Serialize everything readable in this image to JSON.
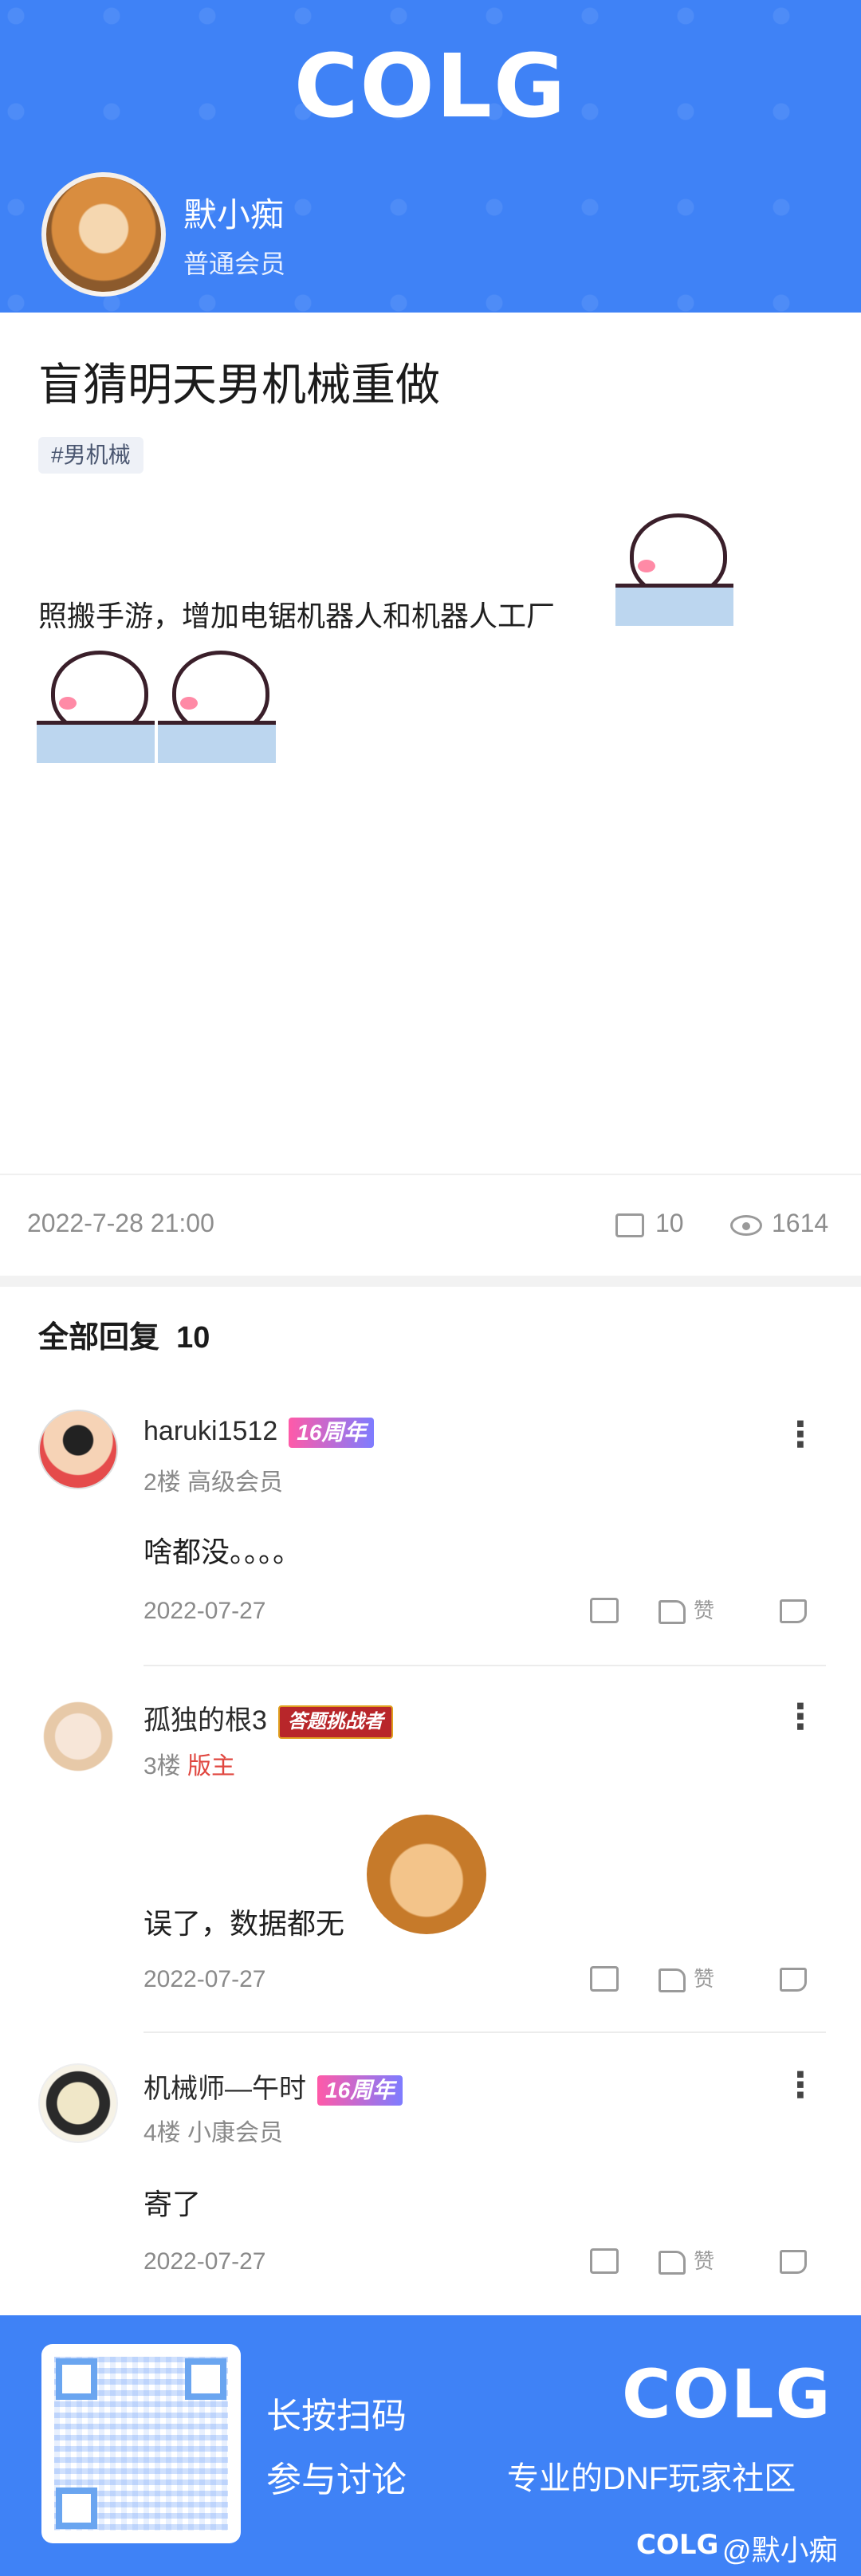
{
  "header": {
    "logo_text": "COLG",
    "user": {
      "name": "默小痴",
      "group": "普通会员"
    }
  },
  "post": {
    "title": "盲猜明天男机械重做",
    "tag": "#男机械",
    "body": "照搬手游，增加电锯机器人和机器人工厂",
    "date": "2022-7-28 21:00",
    "comment_count": "10",
    "view_count": "1614"
  },
  "replies": {
    "title": "全部回复",
    "count": "10",
    "like_label": "赞",
    "items": [
      {
        "username": "haruki1512",
        "badge": "16周年",
        "floor": "2楼",
        "rank": "高级会员",
        "content": "啥都没。。。。",
        "date": "2022-07-27"
      },
      {
        "username": "孤独的根3",
        "badge": "答题挑战者",
        "floor": "3楼",
        "rank": "版主",
        "content": "误了，数据都无",
        "date": "2022-07-27"
      },
      {
        "username": "机械师—午时",
        "badge": "16周年",
        "floor": "4楼",
        "rank": "小康会员",
        "content": "寄了",
        "date": "2022-07-27"
      }
    ]
  },
  "footer": {
    "scan_line1": "长按扫码",
    "scan_line2": "参与讨论",
    "logo_text": "COLG",
    "slogan": "专业的DNF玩家社区",
    "watermark_logo": "COLG",
    "watermark_user": "@默小痴"
  },
  "colors": {
    "brand_blue": "#3f82f6",
    "moderator_red": "#e0463f"
  }
}
